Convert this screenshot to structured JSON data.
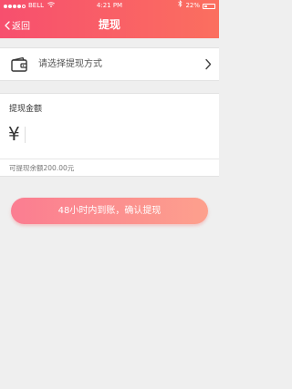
{
  "status_bar": {
    "carrier": "BELL",
    "time": "4:21 PM",
    "battery": "22%",
    "signal_level": 4,
    "signal_max": 5,
    "battery_level": 0.22
  },
  "nav": {
    "back_label": "返回",
    "title": "提现"
  },
  "method": {
    "placeholder": "请选择提现方式"
  },
  "amount": {
    "label": "提现金额",
    "currency_symbol": "¥",
    "value": "",
    "balance_text": "可提现余额200.00元"
  },
  "confirm": {
    "label": "48小时内到账，确认提现"
  },
  "colors": {
    "header_start": "#f74f6e",
    "header_end": "#fb6f5f",
    "button_start": "#fb7d91",
    "button_end": "#fda08d",
    "background": "#efefef"
  }
}
